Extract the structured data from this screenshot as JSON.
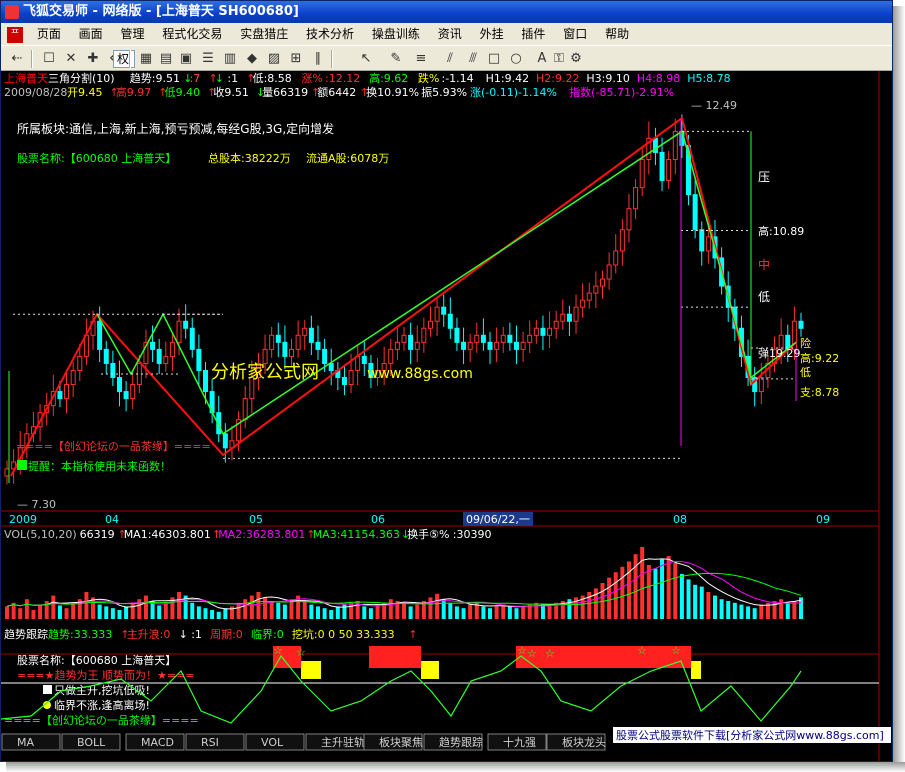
{
  "window": {
    "title": "飞狐交易师 - 网络版 - [上海普天 SH600680]"
  },
  "menu": {
    "app_icon": "ᄑ",
    "items": [
      "页面",
      "画面",
      "管理",
      "程式化交易",
      "实盘猎庄",
      "技术分析",
      "操盘训练",
      "资讯",
      "外挂",
      "插件",
      "窗口",
      "帮助"
    ]
  },
  "toolbar": {
    "dropdown": "权",
    "icons": [
      "open-icon",
      "restore-icon",
      "close-icon",
      "add-icon",
      "remove-icon",
      "dropdown-right-icon",
      "grid-icon",
      "tile-icon",
      "calc-icon",
      "list-icon",
      "stats-icon",
      "alert-icon",
      "image-icon",
      "chart-icon",
      "bars-icon",
      "pointer-icon",
      "pen-icon",
      "line-icon",
      "fan-icon",
      "cross-icon",
      "rect-icon",
      "ellipse-icon",
      "text-icon",
      "lock-icon",
      "settings-icon"
    ]
  },
  "header": {
    "line1": [
      {
        "t": "上海普天",
        "c": "#ff0000"
      },
      {
        "t": " 三角分割(10) ",
        "c": "#ffffff"
      },
      {
        "t": "趋势:9.51",
        "c": "#ffffff"
      },
      {
        "t": "↓",
        "c": "#00ff00"
      },
      {
        "t": " :7",
        "c": "#ff5050"
      },
      {
        "t": "↑",
        "c": "#ff3030"
      },
      {
        "t": " ↓",
        "c": "#00ff00"
      },
      {
        "t": " :1",
        "c": "#ffffff"
      },
      {
        "t": "↑",
        "c": "#ff3030"
      },
      {
        "t": " 低:8.58",
        "c": "#ffffff"
      },
      {
        "t": " 涨%",
        "c": "#ff3030"
      },
      {
        "t": " :12.12",
        "c": "#ff3030"
      },
      {
        "t": " 高:9.62",
        "c": "#00ff00"
      },
      {
        "t": " 跌%",
        "c": "#ffff00"
      },
      {
        "t": " :-1.14",
        "c": "#ffffff"
      },
      {
        "t": " H1:9.42",
        "c": "#ffffff"
      },
      {
        "t": " H2:9.22",
        "c": "#ff3030"
      },
      {
        "t": " H3:9.10",
        "c": "#ffffff"
      },
      {
        "t": " H4:8.98",
        "c": "#ff00ff"
      },
      {
        "t": " H5:8.78",
        "c": "#00ffff"
      }
    ],
    "line2": [
      {
        "t": "2009/08/28",
        "c": "#c0c0c0"
      },
      {
        "t": " 开9.45",
        "c": "#ffff00"
      },
      {
        "t": "↑",
        "c": "#ff3030"
      },
      {
        "t": " 高9.97",
        "c": "#ff3030"
      },
      {
        "t": "↑",
        "c": "#ff3030"
      },
      {
        "t": " 低9.40",
        "c": "#00ff00"
      },
      {
        "t": "↑",
        "c": "#ff3030"
      },
      {
        "t": " 收9.51",
        "c": "#ffffff"
      },
      {
        "t": "↓",
        "c": "#00ff00"
      },
      {
        "t": " 量66319",
        "c": "#ffffff"
      },
      {
        "t": "↑",
        "c": "#ff3030"
      },
      {
        "t": " 额6442",
        "c": "#ffffff"
      },
      {
        "t": "↑",
        "c": "#ff3030"
      },
      {
        "t": " 换10.91%",
        "c": "#ffffff"
      },
      {
        "t": " 振5.93%",
        "c": "#ffffff"
      },
      {
        "t": " 涨(-0.11)-1.14%",
        "c": "#00ffff"
      },
      {
        "t": " 指数(-85.71)-2.91%",
        "c": "#ff00ff"
      }
    ]
  },
  "info": {
    "sector": "所属板块:通信,上海,新上海,预亏预减,每经G股,3G,定向增发",
    "stock_name": "股票名称:【600680 上海普天】",
    "total_shares": "总股本:38222万",
    "float_shares": "流通A股:6078万"
  },
  "watermark": {
    "text1": "分析家公式网",
    "text2": "www.88gs.com"
  },
  "price_labels": {
    "top": "12.49",
    "bottom": "7.30",
    "ya": "压",
    "high": "高:10.89",
    "mid": "中",
    "low": "低",
    "tan": "弹19.29",
    "xian": "险",
    "high2": "高:9.22",
    "di": "低",
    "support": "支:8.78",
    "zhong2": "中"
  },
  "notes": {
    "forum": "====【创幻论坛の一品茶缘】====",
    "warn": "提醒：本指标使用未来函数！"
  },
  "dates": {
    "labels": [
      "2009",
      "04",
      "05",
      "06",
      "08",
      "09"
    ],
    "cursor": "09/06/22,一"
  },
  "vol": {
    "line": [
      {
        "t": "VOL(5,10,20)",
        "c": "#c0c0c0"
      },
      {
        "t": " 66319",
        "c": "#ffffff"
      },
      {
        "t": "↑",
        "c": "#ff3030"
      },
      {
        "t": " MA1:46303.801",
        "c": "#ffffff"
      },
      {
        "t": "↑",
        "c": "#ff3030"
      },
      {
        "t": " MA2:36283.801",
        "c": "#ff00ff"
      },
      {
        "t": "↑",
        "c": "#ff3030"
      },
      {
        "t": " MA3:41154.363",
        "c": "#00ff00"
      },
      {
        "t": "↓",
        "c": "#00ff00"
      },
      {
        "t": " 换手⑤%",
        "c": "#ffffff"
      },
      {
        "t": " :30390",
        "c": "#ffffff"
      }
    ]
  },
  "trend": {
    "line": [
      {
        "t": "趋势跟踪",
        "c": "#ffffff"
      },
      {
        "t": " 趋势:33.333",
        "c": "#00ff00"
      },
      {
        "t": "↑",
        "c": "#ff3030"
      },
      {
        "t": " 主升浪:0",
        "c": "#ff3030"
      },
      {
        "t": " ↓",
        "c": "#ffffff"
      },
      {
        "t": " :1",
        "c": "#ffffff"
      },
      {
        "t": " 周期:0",
        "c": "#ff3030"
      },
      {
        "t": " 临界:0",
        "c": "#00ff00"
      },
      {
        "t": " 挖坑:0 0 50 33.333",
        "c": "#ffff00"
      },
      {
        "t": "↑",
        "c": "#ff3030"
      }
    ],
    "stock": "股票名称:【600680 上海普天】",
    "slogan": "趋势为王 顺势而为！★",
    "tip1": "只做主升,挖坑低吸!",
    "tip2": "临界不涨,逢高离场!",
    "forum": "====【创幻论坛の一品茶缘】===="
  },
  "tabs": [
    "MA",
    "BOLL",
    "MACD",
    "RSI",
    "VOL",
    "主升驻轨",
    "板块聚焦",
    "趋势跟踪",
    "十九强",
    "板块龙头"
  ],
  "footer_banner": "股票公式股票软件下载[分析家公式网www.88gs.com]"
}
